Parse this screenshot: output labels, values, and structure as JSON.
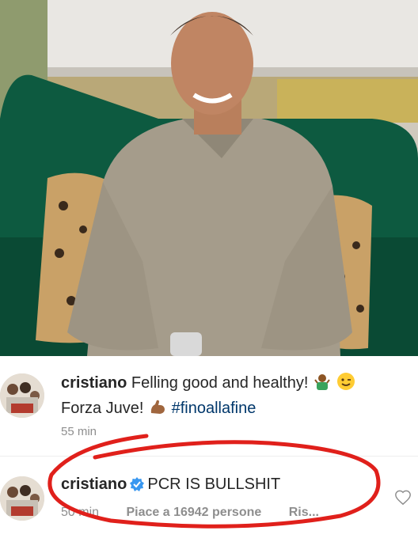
{
  "post": {
    "photo_alt": "post photo",
    "caption": {
      "username": "cristiano",
      "line1": "Felling good and healthy!",
      "line2_text": "Forza Juve!",
      "hashtag": "#finoallafine",
      "time": "55 min"
    }
  },
  "comment": {
    "username": "cristiano",
    "text": "PCR IS BULLSHIT",
    "time": "50 min",
    "likes": "Piace a 16942 persone",
    "reply": "Ris..."
  },
  "icons": {
    "verified": "verified-badge-icon",
    "like": "heart-icon",
    "emoji1": "person-shrugging-icon",
    "emoji2": "winking-face-icon",
    "emoji3": "flexed-biceps-icon"
  },
  "colors": {
    "hashtag": "#00376b",
    "verified": "#3897f0",
    "annotation": "#e0201b"
  }
}
